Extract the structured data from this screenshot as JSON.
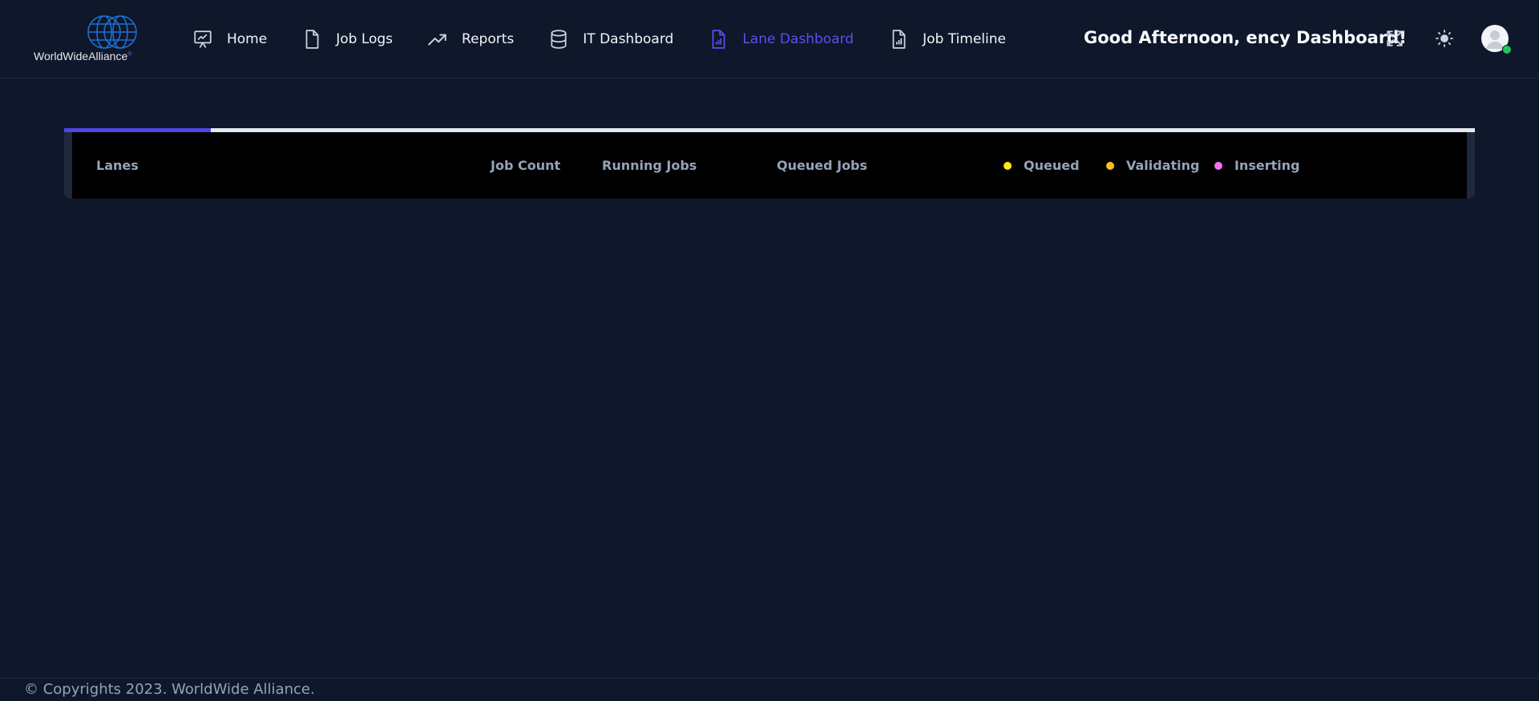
{
  "brand": {
    "name": "WorldWideAlliance",
    "mark": "®"
  },
  "nav": {
    "items": [
      {
        "label": "Home",
        "icon": "presentation-chart-icon"
      },
      {
        "label": "Job Logs",
        "icon": "document-icon"
      },
      {
        "label": "Reports",
        "icon": "trending-up-icon"
      },
      {
        "label": "IT Dashboard",
        "icon": "database-icon"
      },
      {
        "label": "Lane Dashboard",
        "icon": "document-chart-icon",
        "active": true
      },
      {
        "label": "Job Timeline",
        "icon": "document-chart-icon"
      }
    ],
    "active_color": "#5b4ff0"
  },
  "header": {
    "greeting": "Good Afternoon, ency Dashboard!",
    "tools": [
      "expand-icon",
      "sun-icon",
      "user-avatar"
    ],
    "status_color": "#22c55e"
  },
  "loading": {
    "progress_fraction": 0.104,
    "fill_color": "#4f46e5"
  },
  "table": {
    "headers": [
      "Lanes",
      "Job Count",
      "Running Jobs",
      "Queued Jobs"
    ],
    "legend": [
      {
        "label": "Queued",
        "color": "#fde910"
      },
      {
        "label": "Validating",
        "color": "#fbbf24"
      },
      {
        "label": "Inserting",
        "color": "#f472f0"
      }
    ],
    "rows": []
  },
  "footer": {
    "text": "© Copyrights 2023. WorldWide Alliance."
  }
}
